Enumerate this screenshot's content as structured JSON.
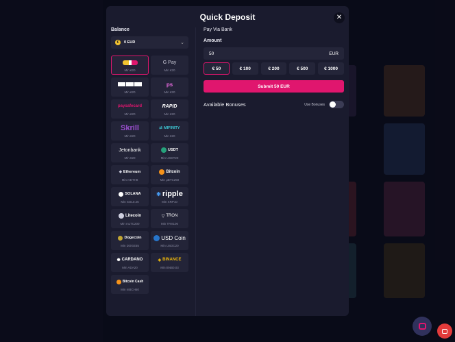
{
  "modal": {
    "title": "Quick Deposit",
    "close_icon": "✕"
  },
  "balance": {
    "label": "Balance",
    "value": "0 EUR"
  },
  "payment_methods": [
    {
      "name": "skrill-1tap",
      "logo": "",
      "min": "Min €20",
      "selected": true
    },
    {
      "name": "google-pay",
      "logo": "G Pay",
      "min": "Min €20"
    },
    {
      "name": "cards",
      "logo": "",
      "min": "Min €20"
    },
    {
      "name": "ps",
      "logo": "ps",
      "min": "Min €20"
    },
    {
      "name": "paysafecard",
      "logo": "paysafecard",
      "min": "Min €20"
    },
    {
      "name": "rapid",
      "logo": "RAPID",
      "min": "Min €20"
    },
    {
      "name": "skrill",
      "logo": "Skrill",
      "min": "Min €20"
    },
    {
      "name": "mifinity",
      "logo": "MIFINITY",
      "min": "Min €20"
    },
    {
      "name": "jetonbank",
      "logo": "Jetonbank",
      "min": "Min €20"
    },
    {
      "name": "usdt",
      "logo": "USDT",
      "min": "Min USDT20"
    },
    {
      "name": "ethereum",
      "logo": "Ethereum",
      "min": "Min mETH8"
    },
    {
      "name": "bitcoin",
      "logo": "Bitcoin",
      "min": "Min μBTC250"
    },
    {
      "name": "solana",
      "logo": "SOLANA",
      "min": "Min SOL0.25"
    },
    {
      "name": "ripple",
      "logo": "ripple",
      "min": "Min XRP10"
    },
    {
      "name": "litecoin",
      "logo": "Litecoin",
      "min": "Min mLTC200"
    },
    {
      "name": "tron",
      "logo": "TRON",
      "min": "Min TRX100"
    },
    {
      "name": "dogecoin",
      "logo": "Dogecoin",
      "min": "Min DOGE55"
    },
    {
      "name": "usd-coin",
      "logo": "USD Coin",
      "min": "Min USDC20"
    },
    {
      "name": "cardano",
      "logo": "CARDANO",
      "min": "Min ADA20"
    },
    {
      "name": "binance",
      "logo": "BINANCE",
      "min": "Min BNB0.03"
    },
    {
      "name": "bitcoin-cash",
      "logo": "Bitcoin Cash",
      "min": "Min mBCH60"
    }
  ],
  "right": {
    "pay_via": "Pay Via Bank",
    "amount_label": "Amount",
    "amount_value": "50",
    "currency": "EUR",
    "quick_amounts": [
      "€ 50",
      "€ 100",
      "€ 200",
      "€ 500",
      "€ 1000"
    ],
    "submit_label": "Submit 50 EUR",
    "bonuses_label": "Available Bonuses",
    "use_bonuses_label": "Use Bonuses"
  },
  "colors": {
    "accent": "#e0166e",
    "modal_bg": "#1a1b2e",
    "field_bg": "#242539"
  },
  "icons": {
    "close": "close-icon",
    "chevron": "chevron-down-icon",
    "chat": "chat-icon",
    "notification": "notification-icon"
  }
}
